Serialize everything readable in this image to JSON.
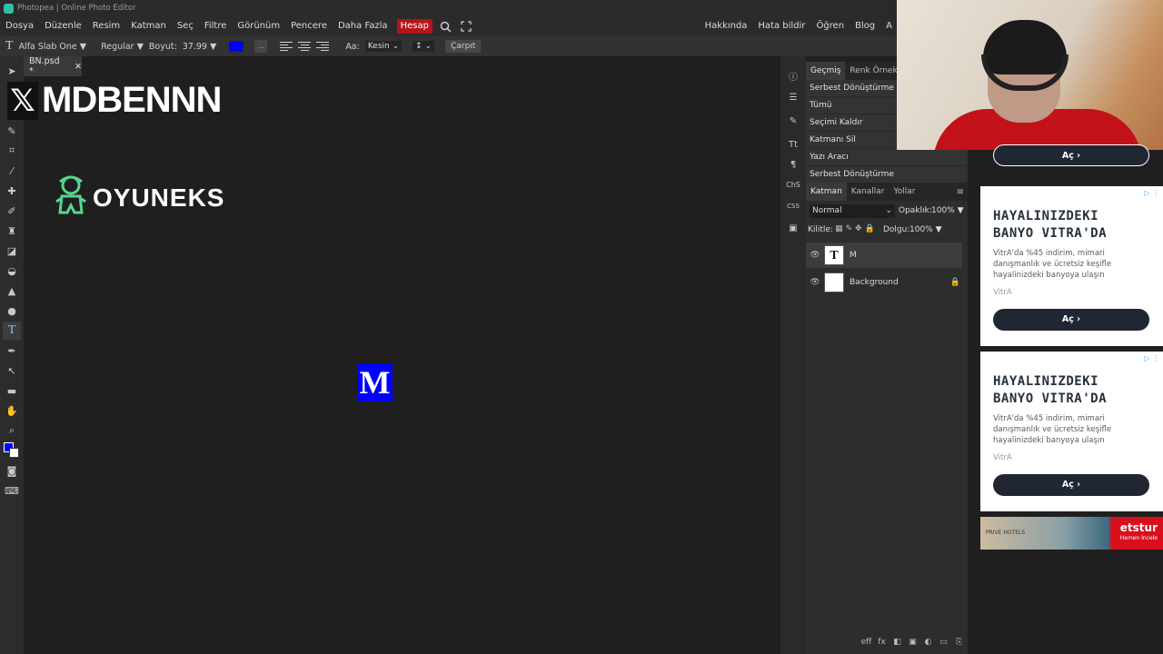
{
  "app": {
    "title": "Photopea | Online Photo Editor"
  },
  "menu": {
    "items": [
      "Dosya",
      "Düzenle",
      "Resim",
      "Katman",
      "Seç",
      "Filtre",
      "Görünüm",
      "Pencere",
      "Daha Fazla"
    ],
    "account": "Hesap",
    "right": [
      "Hakkında",
      "Hata bildir",
      "Öğren",
      "Blog",
      "A"
    ]
  },
  "options": {
    "font": "Alfa Slab One",
    "style": "Regular",
    "size_label": "Boyut:",
    "size_value": "37.99",
    "color": "#0000ff",
    "aa_label": "Aa:",
    "aa_value": "Kesin",
    "warp_label": "Çarpıt",
    "more": "..."
  },
  "document": {
    "tab": "BN.psd *",
    "close": "✕"
  },
  "canvas": {
    "overlay_channel": "MDBENNN",
    "overlay_x": "𝕏",
    "overlay_sponsor": "OYUNEKS",
    "letter": "M",
    "letter_color": "#0000ff"
  },
  "history": {
    "tabs": [
      "Geçmiş",
      "Renk Örnekleri"
    ],
    "items": [
      "Serbest Dönüştürme",
      "Tümü",
      "Seçimi Kaldır",
      "Katmanı Sil",
      "Yazı Aracı",
      "Serbest Dönüştürme"
    ]
  },
  "layers": {
    "tabs": [
      "Katman",
      "Kanallar",
      "Yollar"
    ],
    "blend_mode": "Normal",
    "opacity_label": "Opaklık:",
    "opacity_value": "100%",
    "lock_label": "Kilitle:",
    "fill_label": "Dolgu:",
    "fill_value": "100%",
    "rows": [
      {
        "name": "M",
        "thumb": "T"
      },
      {
        "name": "Background",
        "thumb": ""
      }
    ],
    "footer": [
      "eff",
      "fx",
      "◧",
      "▣",
      "◐",
      "▭",
      "⎘",
      "🗑"
    ]
  },
  "panel_strip": [
    "ⓘ",
    "☰",
    "✎",
    "Tt",
    "¶",
    "ChS",
    "CSS",
    "▣"
  ],
  "ads": [
    {
      "title": "HAYALINIZDEKI BANYO VITRA'DA",
      "body": "VitrA'da %45 indirim, mimari danışmanlık ve ücretsiz keşifle hayalinizdeki banyoya ulaşın",
      "brand": "VitrA",
      "cta": "Aç ›"
    },
    {
      "title": "HAYALINIZDEKI BANYO VITRA'DA",
      "body": "VitrA'da %45 indirim, mimari danışmanlık ve ücretsiz keşifle hayalinizdeki banyoya ulaşın",
      "brand": "VitrA",
      "cta": "Aç ›"
    }
  ],
  "ad_top_cta": "Aç ›",
  "banner": {
    "brand": "etstur",
    "cta": "Hemen İncele",
    "hotel": "PRIVE HOTELS"
  }
}
